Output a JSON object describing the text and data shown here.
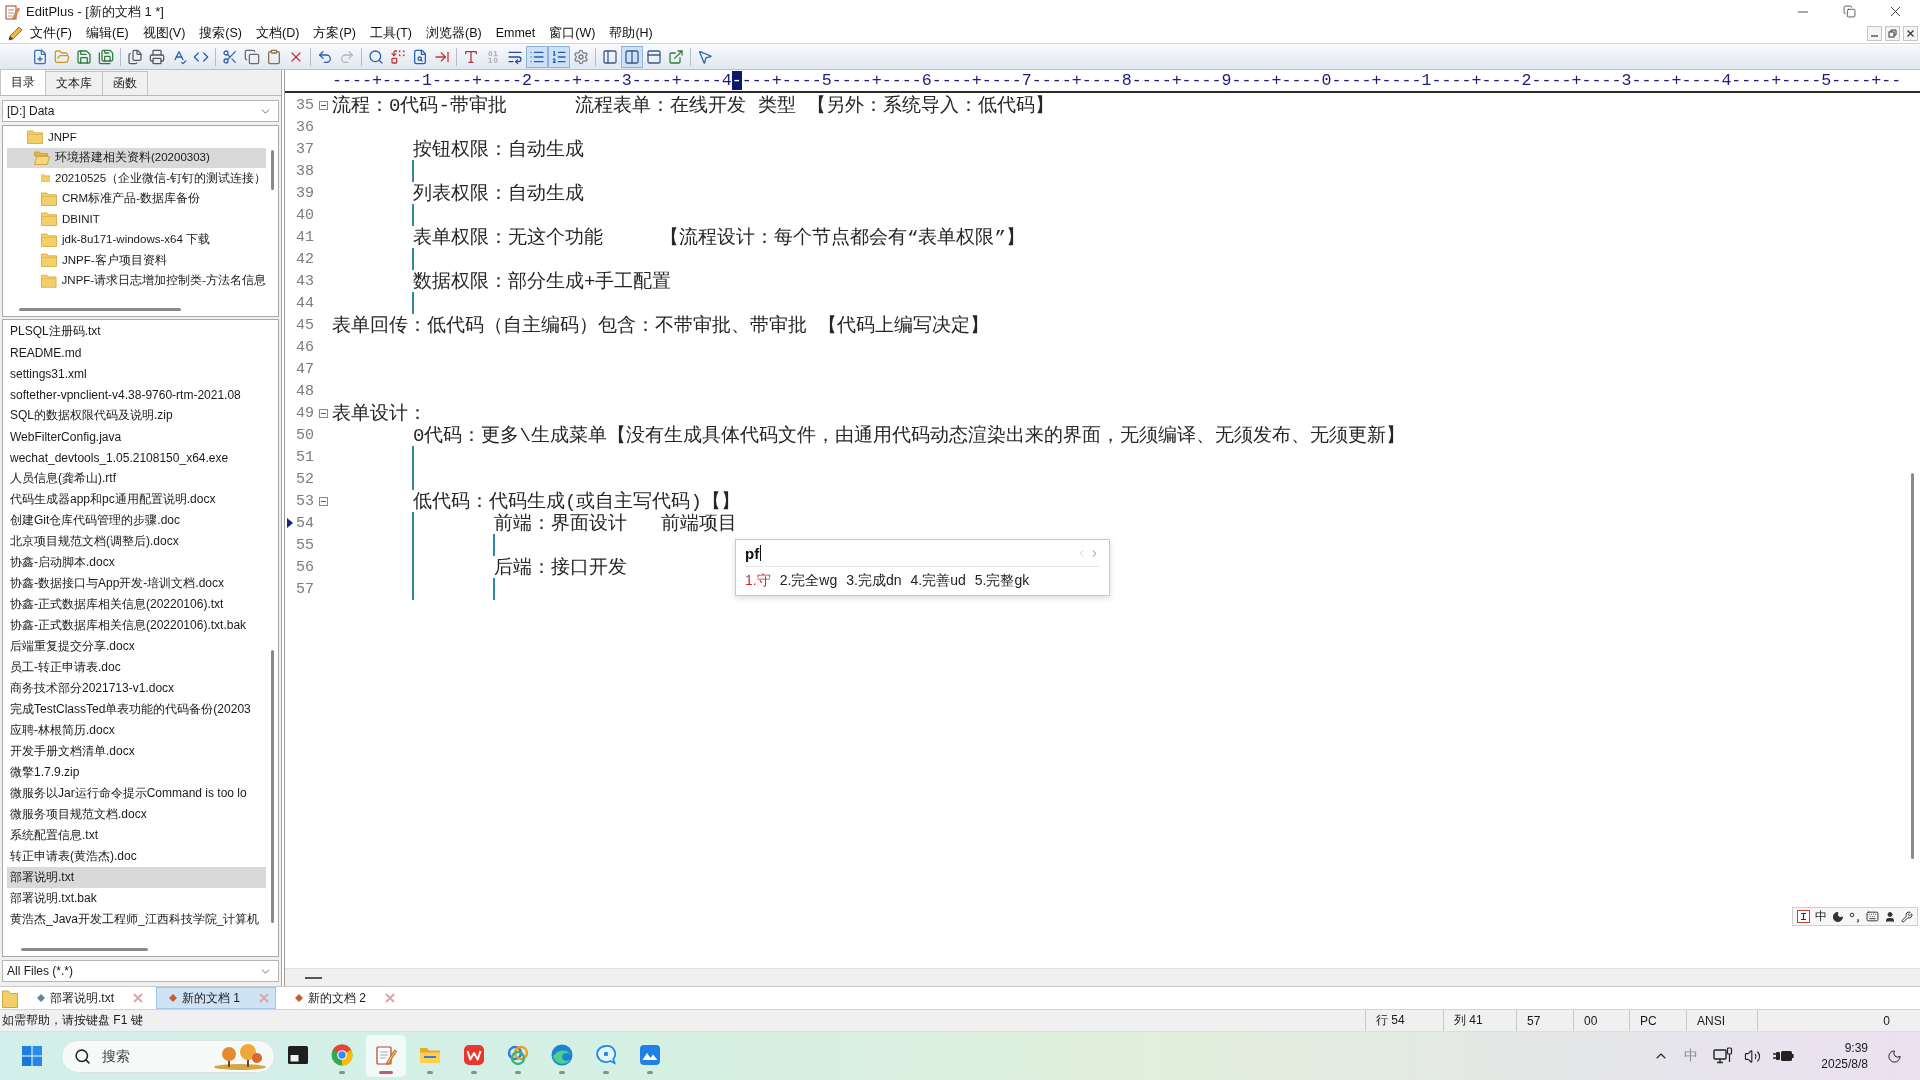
{
  "window": {
    "title": "EditPlus - [新的文档 1 *]"
  },
  "menu": [
    "文件(F)",
    "编辑(E)",
    "视图(V)",
    "搜索(S)",
    "文档(D)",
    "方案(P)",
    "工具(T)",
    "浏览器(B)",
    "Emmet",
    "窗口(W)",
    "帮助(H)"
  ],
  "toolbar": [
    [
      {
        "kind": "new",
        "pressed": false,
        "disabled": false
      },
      {
        "kind": "open",
        "pressed": false,
        "disabled": false
      },
      {
        "kind": "save",
        "pressed": false,
        "disabled": false
      },
      {
        "kind": "save-all",
        "pressed": false,
        "disabled": false
      }
    ],
    [
      {
        "kind": "print-preview",
        "pressed": false,
        "disabled": false
      },
      {
        "kind": "print",
        "pressed": false,
        "disabled": false
      },
      {
        "kind": "spellcheck",
        "pressed": false,
        "disabled": false
      },
      {
        "kind": "preview",
        "pressed": false,
        "disabled": false
      }
    ],
    [
      {
        "kind": "cut",
        "pressed": false,
        "disabled": false
      },
      {
        "kind": "copy",
        "pressed": false,
        "disabled": false
      },
      {
        "kind": "paste",
        "pressed": false,
        "disabled": false
      },
      {
        "kind": "delete",
        "pressed": false,
        "disabled": false
      }
    ],
    [
      {
        "kind": "undo",
        "pressed": false,
        "disabled": false
      },
      {
        "kind": "redo",
        "pressed": false,
        "disabled": true
      }
    ],
    [
      {
        "kind": "find",
        "pressed": false,
        "disabled": false
      },
      {
        "kind": "replace",
        "pressed": false,
        "disabled": false
      },
      {
        "kind": "find-in-files",
        "pressed": false,
        "disabled": false
      },
      {
        "kind": "goto-line",
        "pressed": false,
        "disabled": false
      }
    ],
    [
      {
        "kind": "font",
        "pressed": false,
        "disabled": false
      },
      {
        "kind": "hex",
        "pressed": false,
        "disabled": true
      },
      {
        "kind": "word-wrap",
        "pressed": false,
        "disabled": false
      },
      {
        "kind": "indent",
        "pressed": true,
        "disabled": false
      },
      {
        "kind": "line-numbers",
        "pressed": true,
        "disabled": false
      },
      {
        "kind": "settings",
        "pressed": false,
        "disabled": false
      }
    ],
    [
      {
        "kind": "panel-left",
        "pressed": false,
        "disabled": false
      },
      {
        "kind": "columns",
        "pressed": true,
        "disabled": false
      },
      {
        "kind": "panel-top",
        "pressed": false,
        "disabled": false
      },
      {
        "kind": "external",
        "pressed": false,
        "disabled": false
      }
    ],
    [
      {
        "kind": "help",
        "pressed": false,
        "disabled": false
      }
    ]
  ],
  "sidebar": {
    "tabs": [
      {
        "label": "目录",
        "selected": true
      },
      {
        "label": "文本库",
        "selected": false
      },
      {
        "label": "函数",
        "selected": false
      }
    ],
    "drive": "[D:] Data",
    "tree": [
      {
        "label": "JNPF",
        "selected": false,
        "children": [
          {
            "label": "环境搭建相关资料(20200303)",
            "selected": true,
            "children": [
              {
                "label": "20210525（企业微信-钉钉的测试连接）",
                "selected": false
              },
              {
                "label": "CRM标准产品-数据库备份",
                "selected": false
              },
              {
                "label": "DBINIT",
                "selected": false
              },
              {
                "label": "jdk-8u171-windows-x64 下载",
                "selected": false
              },
              {
                "label": "JNPF-客户项目资料",
                "selected": false
              },
              {
                "label": "JNPF-请求日志增加控制类-方法名信息",
                "selected": false
              }
            ]
          }
        ]
      }
    ],
    "files": [
      {
        "name": "PLSQL注册码.txt",
        "selected": false
      },
      {
        "name": "README.md",
        "selected": false
      },
      {
        "name": "settings31.xml",
        "selected": false
      },
      {
        "name": "softether-vpnclient-v4.38-9760-rtm-2021.08",
        "selected": false
      },
      {
        "name": "SQL的数据权限代码及说明.zip",
        "selected": false
      },
      {
        "name": "WebFilterConfig.java",
        "selected": false
      },
      {
        "name": "wechat_devtools_1.05.2108150_x64.exe",
        "selected": false
      },
      {
        "name": "人员信息(龚希山).rtf",
        "selected": false
      },
      {
        "name": "代码生成器app和pc通用配置说明.docx",
        "selected": false
      },
      {
        "name": "创建Git仓库代码管理的步骤.doc",
        "selected": false
      },
      {
        "name": "北京项目规范文档(调整后).docx",
        "selected": false
      },
      {
        "name": "协鑫-启动脚本.docx",
        "selected": false
      },
      {
        "name": "协鑫-数据接口与App开发-培训文档.docx",
        "selected": false
      },
      {
        "name": "协鑫-正式数据库相关信息(20220106).txt",
        "selected": false
      },
      {
        "name": "协鑫-正式数据库相关信息(20220106).txt.bak",
        "selected": false
      },
      {
        "name": "后端重复提交分享.docx",
        "selected": false
      },
      {
        "name": "员工-转正申请表.doc",
        "selected": false
      },
      {
        "name": "商务技术部分2021713-v1.docx",
        "selected": false
      },
      {
        "name": "完成TestClassTed单表功能的代码备份(20203",
        "selected": false
      },
      {
        "name": "应聘-林根简历.docx",
        "selected": false
      },
      {
        "name": "开发手册文档清单.docx",
        "selected": false
      },
      {
        "name": "微擎1.7.9.zip",
        "selected": false
      },
      {
        "name": "微服务以Jar运行命令提示Command is too lo",
        "selected": false
      },
      {
        "name": "微服务项目规范文档.docx",
        "selected": false
      },
      {
        "name": "系统配置信息.txt",
        "selected": false
      },
      {
        "name": "转正申请表(黄浩杰).doc",
        "selected": false
      },
      {
        "name": "部署说明.txt",
        "selected": true
      },
      {
        "name": "部署说明.txt.bak",
        "selected": false
      },
      {
        "name": "黄浩杰_Java开发工程师_江西科技学院_计算机",
        "selected": false
      }
    ],
    "filter": "All Files (*.*)"
  },
  "editor": {
    "ruler": {
      "left": "----+----1----+----2----+----3----+----4",
      "cursor": "-",
      "right": "---+----5----+----6----+----7----+----8----+----9----+----0----+----1----+----2----+----3----+----4----+----5----+--"
    },
    "lines": [
      {
        "number": "35",
        "text": "流程：0代码-带审批      流程表单：在线开发 类型 【另外：系统导入：低代码】",
        "current": false,
        "expanded": true,
        "children": [
          {
            "number": "36",
            "current": false,
            "guide": false
          },
          {
            "number": "37",
            "text": "按钮权限：自动生成",
            "current": false
          },
          {
            "number": "38",
            "current": false,
            "guide": true
          },
          {
            "number": "39",
            "text": "列表权限：自动生成",
            "current": false
          },
          {
            "number": "40",
            "current": false,
            "guide": true
          },
          {
            "number": "41",
            "text": "表单权限：无这个功能     【流程设计：每个节点都会有“表单权限”】",
            "current": false
          },
          {
            "number": "42",
            "current": false,
            "guide": true
          },
          {
            "number": "43",
            "text": "数据权限：部分生成+手工配置",
            "current": false
          },
          {
            "number": "44",
            "current": false,
            "guide": true
          }
        ]
      },
      {
        "number": "45",
        "text": "表单回传：低代码（自主编码）包含：不带审批、带审批 【代码上编写决定】",
        "current": false
      },
      {
        "number": "46",
        "current": false
      },
      {
        "number": "47",
        "current": false
      },
      {
        "number": "48",
        "current": false
      },
      {
        "number": "49",
        "text": "表单设计：",
        "current": false,
        "expanded": true,
        "children": [
          {
            "number": "50",
            "text": "0代码：更多\\生成菜单【没有生成具体代码文件，由通用代码动态渲染出来的界面，无须编译、无须发布、无须更新】",
            "current": false
          },
          {
            "number": "51",
            "current": false,
            "guide": true
          },
          {
            "number": "52",
            "current": false,
            "guide": true
          },
          {
            "number": "53",
            "text": "低代码：代码生成(或自主写代码)【】",
            "current": false,
            "expanded": true,
            "children": [
              {
                "number": "54",
                "text": "前端：界面设计   前端项目",
                "current": true
              },
              {
                "number": "55",
                "current": false,
                "guide": true
              },
              {
                "number": "56",
                "text": "后端：接口开发",
                "current": false
              },
              {
                "number": "57",
                "current": false,
                "guide": true
              }
            ]
          }
        ]
      }
    ],
    "ime": {
      "input": "pf",
      "candidates": [
        {
          "label": "1.守",
          "selected": true
        },
        {
          "label": "2.完全wg",
          "selected": false
        },
        {
          "label": "3.完成dn",
          "selected": false
        },
        {
          "label": "4.完善ud",
          "selected": false
        },
        {
          "label": "5.完整gk",
          "selected": false
        }
      ]
    }
  },
  "ime_toolbar": {
    "mode": "中"
  },
  "document_tabs": [
    {
      "label": "部署说明.txt",
      "selected": false,
      "color": "#5a8a96"
    },
    {
      "label": "新的文档 1",
      "selected": true,
      "color": "#c8602c"
    },
    {
      "label": "新的文档 2",
      "selected": false,
      "color": "#c8602c"
    }
  ],
  "status_bar": {
    "hint": "如需帮助，请按键盘 F1 键",
    "panes": [
      "行 54",
      "列 41",
      "57",
      "00",
      "PC",
      "ANSI",
      "0"
    ]
  },
  "taskbar": {
    "search": {
      "placeholder": "搜索"
    },
    "apps": [
      {
        "kind": "window",
        "running": false,
        "active": false
      },
      {
        "kind": "browser",
        "running": true,
        "active": false
      },
      {
        "kind": "editor",
        "running": true,
        "active": true
      },
      {
        "kind": "files",
        "running": true,
        "active": false
      },
      {
        "kind": "office",
        "running": true,
        "active": false
      },
      {
        "kind": "rings",
        "running": true,
        "active": false
      },
      {
        "kind": "wave",
        "running": true,
        "active": false
      },
      {
        "kind": "chat",
        "running": true,
        "active": false
      },
      {
        "kind": "tile",
        "running": true,
        "active": false
      }
    ],
    "ime_indicator": "中",
    "clock": {
      "time": "9:39",
      "date": "2025/8/8"
    }
  }
}
